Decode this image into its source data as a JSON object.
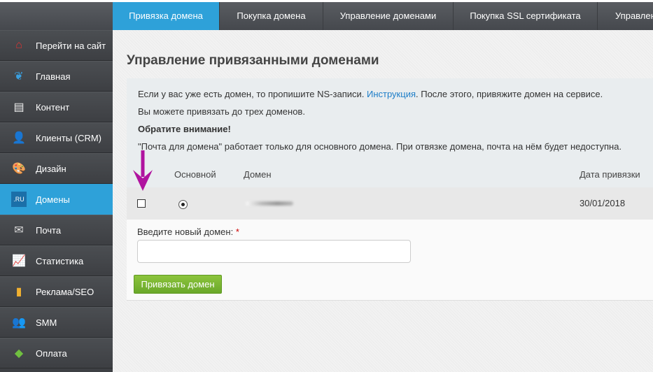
{
  "tabs": [
    {
      "label": "Привязка домена",
      "active": true
    },
    {
      "label": "Покупка домена"
    },
    {
      "label": "Управление доменами"
    },
    {
      "label": "Покупка SSL сертификата"
    },
    {
      "label": "Управлен"
    }
  ],
  "sidebar": [
    {
      "label": "Перейти на сайт",
      "icon": "home-icon"
    },
    {
      "label": "Главная",
      "icon": "butterfly-icon"
    },
    {
      "label": "Контент",
      "icon": "document-icon"
    },
    {
      "label": "Клиенты (CRM)",
      "icon": "user-icon"
    },
    {
      "label": "Дизайн",
      "icon": "palette-icon"
    },
    {
      "label": "Домены",
      "icon": "ru-domain-icon",
      "active": true
    },
    {
      "label": "Почта",
      "icon": "mail-icon"
    },
    {
      "label": "Статистика",
      "icon": "chart-icon"
    },
    {
      "label": "Реклама/SEO",
      "icon": "bars-icon"
    },
    {
      "label": "SMM",
      "icon": "people-icon"
    },
    {
      "label": "Оплата",
      "icon": "payment-icon"
    }
  ],
  "page": {
    "title": "Управление привязанными доменами",
    "info": {
      "line1_pre": "Если у вас уже есть домен, то пропишите NS-записи. ",
      "link": "Инструкция",
      "line1_post": ". После этого, привяжите домен на сервисе.",
      "line2": "Вы можете привязать до трех доменов.",
      "attention": "Обратите внимание!",
      "line4": "\"Почта для домена\" работает только для основного домена. При отвязке домена, почта на нём будет недоступна."
    },
    "table": {
      "headers": {
        "main": "Основной",
        "domain": "Домен",
        "date": "Дата привязки"
      },
      "rows": [
        {
          "date": "30/01/2018",
          "main": true,
          "checked": false
        }
      ]
    },
    "form": {
      "label": "Введите новый домен:",
      "required": "*",
      "value": "",
      "button": "Привязать домен"
    }
  },
  "colors": {
    "accent": "#2ea1d9",
    "button": "#7ab733",
    "arrow": "#b0139f"
  }
}
